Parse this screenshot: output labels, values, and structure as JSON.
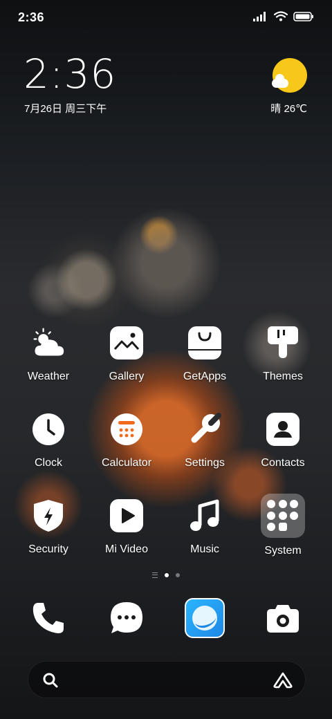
{
  "status_bar": {
    "time": "2:36"
  },
  "clock_widget": {
    "time": "2:36",
    "date": "7月26日 周三下午"
  },
  "weather_widget": {
    "text": "晴 26℃"
  },
  "apps": {
    "weather": "Weather",
    "gallery": "Gallery",
    "getapps": "GetApps",
    "themes": "Themes",
    "clock": "Clock",
    "calculator": "Calculator",
    "settings": "Settings",
    "contacts": "Contacts",
    "security": "Security",
    "mivideo": "Mi Video",
    "music": "Music",
    "system": "System"
  },
  "pager": {
    "page_count": 2,
    "active_page": 1
  },
  "colors": {
    "sun": "#f7c81a",
    "browser": "#1e88e5",
    "calculator_accent": "#f26b1d"
  }
}
